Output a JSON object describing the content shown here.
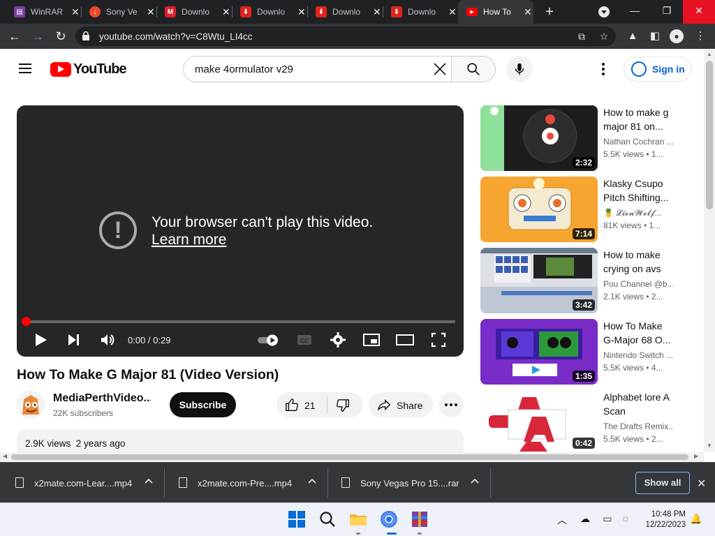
{
  "browser": {
    "tabs": [
      {
        "label": "WinRAR",
        "icon_color": "#7a3fa1"
      },
      {
        "label": "Sony Ve",
        "icon_color": "#ea4b2a"
      },
      {
        "label": "Downlo",
        "icon_color": "#db1f2b"
      },
      {
        "label": "Downlo",
        "icon_color": "#e0231c"
      },
      {
        "label": "Downlo",
        "icon_color": "#e0231c"
      },
      {
        "label": "Downlo",
        "icon_color": "#e0231c"
      },
      {
        "label": "How To",
        "icon_color": "#ff0000",
        "active": true
      }
    ],
    "url": "youtube.com/watch?v=C8Wtu_LI4cc"
  },
  "youtube": {
    "logo_text": "YouTube",
    "search_query": "make 4ormulator v29",
    "sign_in": "Sign in"
  },
  "player": {
    "error_line1": "Your browser can't play this video.",
    "error_link": "Learn more",
    "time": "0:00 / 0:29",
    "progress_fraction": 0.0
  },
  "video": {
    "title": "How To Make G Major 81 (Video Version)",
    "channel": "MediaPerthVideo...",
    "subscribers": "22K subscribers",
    "subscribe_label": "Subscribe",
    "likes": "21",
    "share_label": "Share",
    "views": "2.9K views",
    "age": "2 years ago"
  },
  "recommendations": [
    {
      "title_line1": "How to make g",
      "title_line2": "major 81 on...",
      "channel": "Nathan Cochran ...",
      "meta": "5.5K views  •  1...",
      "duration": "2:32"
    },
    {
      "title_line1": "Klasky Csupo",
      "title_line2": "Pitch Shifting...",
      "channel": "🍍 𝓛𝓲𝓸𝓷𝓦𝓸𝓵𝓯...",
      "meta": "81K views  •  1...",
      "duration": "7:14"
    },
    {
      "title_line1": "How to make",
      "title_line2": "crying on avs",
      "channel": "Pou Channel @b...",
      "meta": "2.1K views  •  2...",
      "duration": "3:42"
    },
    {
      "title_line1": "How To Make",
      "title_line2": "G-Major 68 O...",
      "channel": "Nintendo Switch ...",
      "meta": "5.5K views  •  4...",
      "duration": "1:35"
    },
    {
      "title_line1": "Alphabet lore A",
      "title_line2": "Scan",
      "channel": "The Drafts Remix...",
      "meta": "5.5K views  •  2...",
      "duration": "0:42"
    }
  ],
  "downloads": {
    "items": [
      {
        "name": "x2mate.com-Lear....mp4"
      },
      {
        "name": "x2mate.com-Pre....mp4"
      },
      {
        "name": "Sony Vegas Pro 15....rar"
      }
    ],
    "show_all": "Show all"
  },
  "taskbar": {
    "time": "10:48 PM",
    "date": "12/22/2023"
  }
}
